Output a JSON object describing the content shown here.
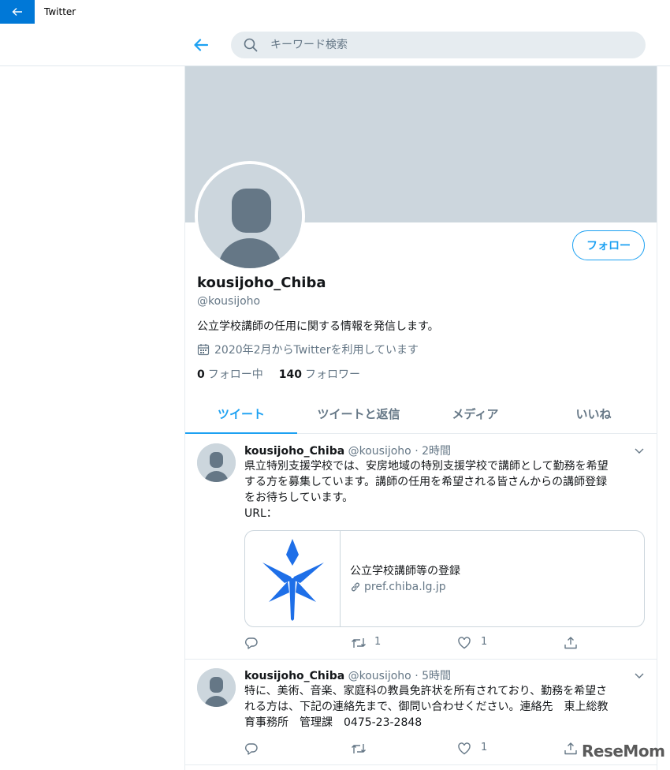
{
  "window": {
    "title": "Twitter"
  },
  "search": {
    "placeholder": "キーワード検索"
  },
  "profile": {
    "display_name": "kousijoho_Chiba",
    "handle": "@kousijoho",
    "bio": "公立学校講師の任用に関する情報を発信します。",
    "joined": "2020年2月からTwitterを利用しています",
    "following_count": "0",
    "following_label": "フォロー中",
    "followers_count": "140",
    "followers_label": "フォロワー",
    "follow_button": "フォロー"
  },
  "tabs": [
    "ツイート",
    "ツイートと返信",
    "メディア",
    "いいね"
  ],
  "tweets": [
    {
      "name": "kousijoho_Chiba",
      "handle": "@kousijoho",
      "sep": "·",
      "time": "2時間",
      "lines": [
        "県立特別支援学校では、安房地域の特別支援学校で講師として勤務を希望",
        "する方を募集しています。講師の任用を希望される皆さんからの講師登録",
        "をお待ちしています。",
        "URL："
      ],
      "card": {
        "title": "公立学校講師等の登録",
        "domain": "pref.chiba.lg.jp"
      },
      "retweets": "1",
      "likes": "1"
    },
    {
      "name": "kousijoho_Chiba",
      "handle": "@kousijoho",
      "sep": "·",
      "time": "5時間",
      "lines": [
        "特に、美術、音楽、家庭科の教員免許状を所有されており、勤務を希望さ",
        "れる方は、下記の連絡先まで、御問い合わせください。連絡先　東上総教",
        "育事務所　管理課　0475-23-2848"
      ],
      "retweets": "",
      "likes": "1"
    }
  ],
  "watermark": "ReseMom",
  "colors": {
    "accent": "#1da1f2",
    "banner": "#ccd6dd",
    "window_accent": "#0078d7",
    "muted": "#657786"
  },
  "icons": [
    "back-arrow-icon",
    "search-icon",
    "calendar-icon",
    "link-icon",
    "reply-icon",
    "retweet-icon",
    "heart-icon",
    "share-icon",
    "chevron-down-icon",
    "chiba-prefecture-emblem"
  ]
}
